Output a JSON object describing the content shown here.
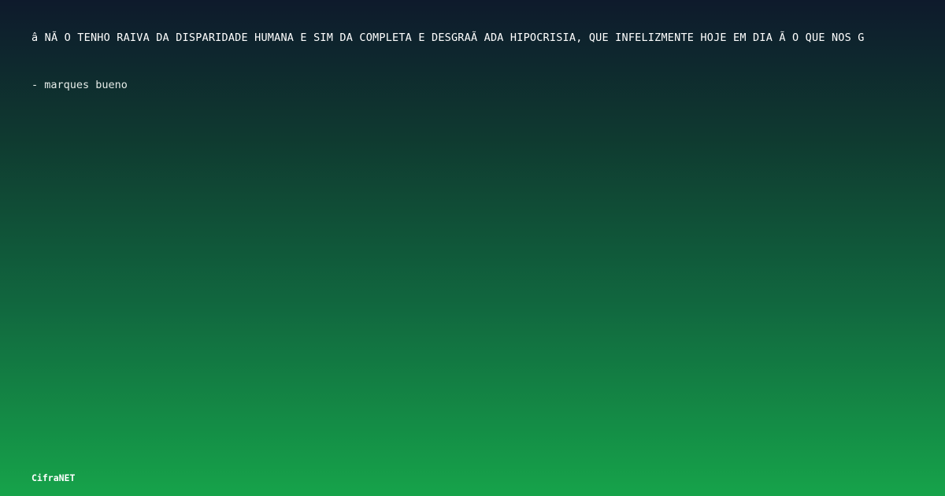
{
  "quote": {
    "text": "â  NÃ O TENHO RAIVA DA DISPARIDADE HUMANA E SIM DA COMPLETA E DESGRAÃ ADA HIPOCRISIA, QUE INFELIZMENTE HOJE EM DIA Ã  O QUE NOS G"
  },
  "author": {
    "text": "- marques bueno"
  },
  "brand": {
    "name": "CifraNET"
  },
  "colors": {
    "gradient_top": "#0e1a2c",
    "gradient_bottom": "#16a34a",
    "text": "#ffffff"
  }
}
